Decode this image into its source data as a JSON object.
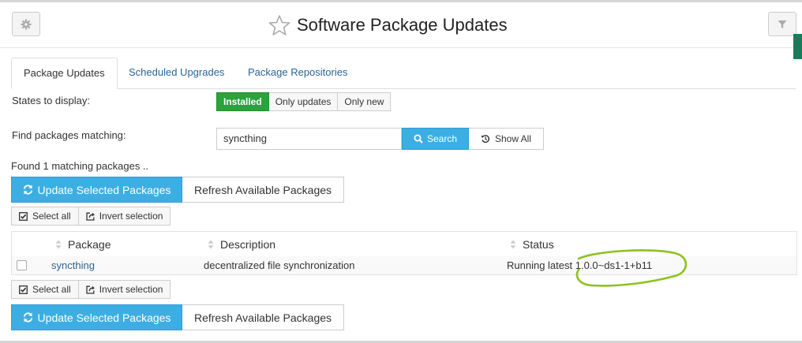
{
  "header": {
    "title": "Software Package Updates",
    "icons": {
      "left": "gear-icon",
      "star": "star-icon",
      "right": "filter-icon"
    }
  },
  "tabs": [
    {
      "label": "Package Updates",
      "active": true
    },
    {
      "label": "Scheduled Upgrades",
      "active": false
    },
    {
      "label": "Package Repositories",
      "active": false
    }
  ],
  "states": {
    "label": "States to display:",
    "options": [
      {
        "label": "Installed",
        "selected": true
      },
      {
        "label": "Only updates",
        "selected": false
      },
      {
        "label": "Only new",
        "selected": false
      }
    ]
  },
  "find": {
    "label": "Find packages matching:",
    "value": "syncthing",
    "search_label": "Search",
    "show_all_label": "Show All"
  },
  "result_text": "Found 1 matching packages ..",
  "actions": {
    "update_label": "Update Selected Packages",
    "refresh_label": "Refresh Available Packages",
    "select_all_label": "Select all",
    "invert_label": "Invert selection"
  },
  "table": {
    "columns": [
      "Package",
      "Description",
      "Status"
    ],
    "rows": [
      {
        "package": "syncthing",
        "description": "decentralized file synchronization",
        "status": "Running latest 1.0.0~ds1-1+b11",
        "checked": false
      }
    ]
  },
  "colors": {
    "accent": "#3daee3",
    "success": "#2ba23c",
    "link": "#2a6496",
    "annotation": "#8dc21f"
  }
}
